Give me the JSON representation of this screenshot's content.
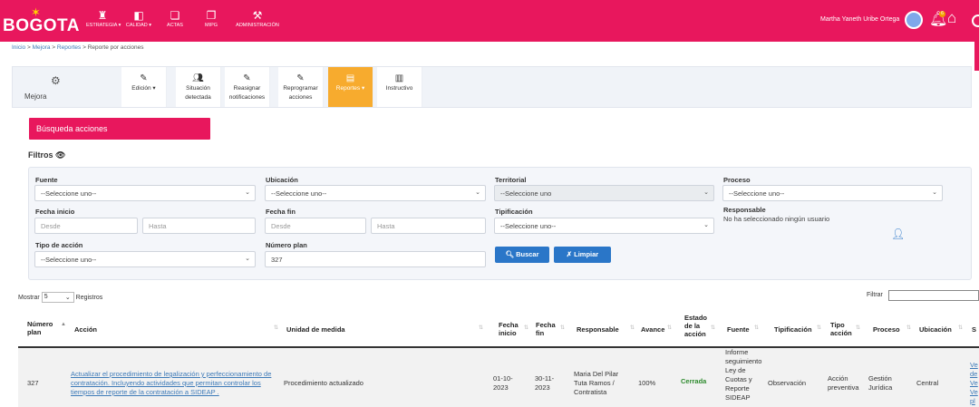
{
  "header": {
    "logo": "BOGOTA",
    "nav": [
      {
        "label": "ESTRATEGIA ▾",
        "icon": "strategy-icon"
      },
      {
        "label": "CALIDAD ▾",
        "icon": "quality-icon"
      },
      {
        "label": "ACTAS",
        "icon": "minutes-icon"
      },
      {
        "label": "MIPG",
        "icon": "mipg-icon"
      },
      {
        "label": "ADMINISTRACIÓN",
        "icon": "admin-icon"
      }
    ],
    "user_name": "Martha Yaneth Uribe Ortega",
    "notification_count": "6",
    "brand_color": "#e8175d"
  },
  "breadcrumb": {
    "home": "Inicio",
    "sep": " > ",
    "level1": "Mejora",
    "level2": "Reportes",
    "current": "Reporte por acciones"
  },
  "module": {
    "label": "Mejora",
    "buttons": [
      {
        "label": "Edición ▾",
        "icon": "pencil-icon"
      },
      {
        "label": "Situación detectada",
        "icon": "people-icon"
      },
      {
        "label": "Reasignar notificaciones",
        "icon": "pencil-icon"
      },
      {
        "label": "Reprogramar acciones",
        "icon": "pencil-icon"
      },
      {
        "label": "Reportes ▾",
        "icon": "report-icon"
      },
      {
        "label": "Instructivo",
        "icon": "book-icon"
      }
    ]
  },
  "search_tab": "Búsqueda acciones",
  "filters": {
    "title": "Filtros",
    "fuente": {
      "label": "Fuente",
      "value": "--Seleccione uno--"
    },
    "ubicacion": {
      "label": "Ubicación",
      "value": "--Seleccione uno--"
    },
    "territorial": {
      "label": "Territorial",
      "value": "--Seleccione uno"
    },
    "proceso": {
      "label": "Proceso",
      "value": "--Seleccione uno--"
    },
    "fecha_inicio": {
      "label": "Fecha inicio",
      "desde": "Desde",
      "hasta": "Hasta"
    },
    "fecha_fin": {
      "label": "Fecha fin",
      "desde": "Desde",
      "hasta": "Hasta"
    },
    "tipificacion": {
      "label": "Tipificación",
      "value": "--Seleccione uno--"
    },
    "responsable": {
      "label": "Responsable",
      "value": "No ha seleccionado ningún usuario"
    },
    "tipo_accion": {
      "label": "Tipo de acción",
      "value": "--Seleccione uno--"
    },
    "numero_plan": {
      "label": "Número plan",
      "value": "327"
    },
    "buscar": "Buscar",
    "limpiar": "Limpiar"
  },
  "table": {
    "show_prefix": "Mostrar",
    "page_size": "5",
    "show_suffix": "Registros",
    "filter_label": "Filtrar",
    "columns": {
      "numero_plan": "Número plan",
      "accion": "Acción",
      "unidad": "Unidad de medida",
      "fecha_inicio": "Fecha inicio",
      "fecha_fin": "Fecha fin",
      "responsable": "Responsable",
      "avance": "Avance",
      "estado": "Estado de la acción",
      "fuente": "Fuente",
      "tipificacion": "Tipificación",
      "tipo_accion": "Tipo acción",
      "proceso": "Proceso",
      "ubicacion": "Ubicación",
      "extra": "S"
    },
    "rows": [
      {
        "numero_plan": "327",
        "accion": "Actualizar el procedimiento de legalización y perfeccionamiento de contratación. Incluyendo actividades que permitan controlar los tiempos de reporte de la contratación a SIDEAP .",
        "unidad": "Procedimiento actualizado",
        "fecha_inicio": "01-10-2023",
        "fecha_fin": "30-11-2023",
        "responsable": "Maria Del Pilar Tuta Ramos / Contratista",
        "avance": "100%",
        "estado": "Cerrada",
        "fuente": "Informe seguimiento Ley de Cuotas y Reporte SIDEAP",
        "tipificacion": "Observación",
        "tipo_accion": "Acción preventiva",
        "proceso": "Gestión Jurídica",
        "ubicacion": "Central",
        "extra_links": [
          "Ve",
          "de",
          "Ve",
          "Ve",
          "pl"
        ]
      }
    ]
  }
}
